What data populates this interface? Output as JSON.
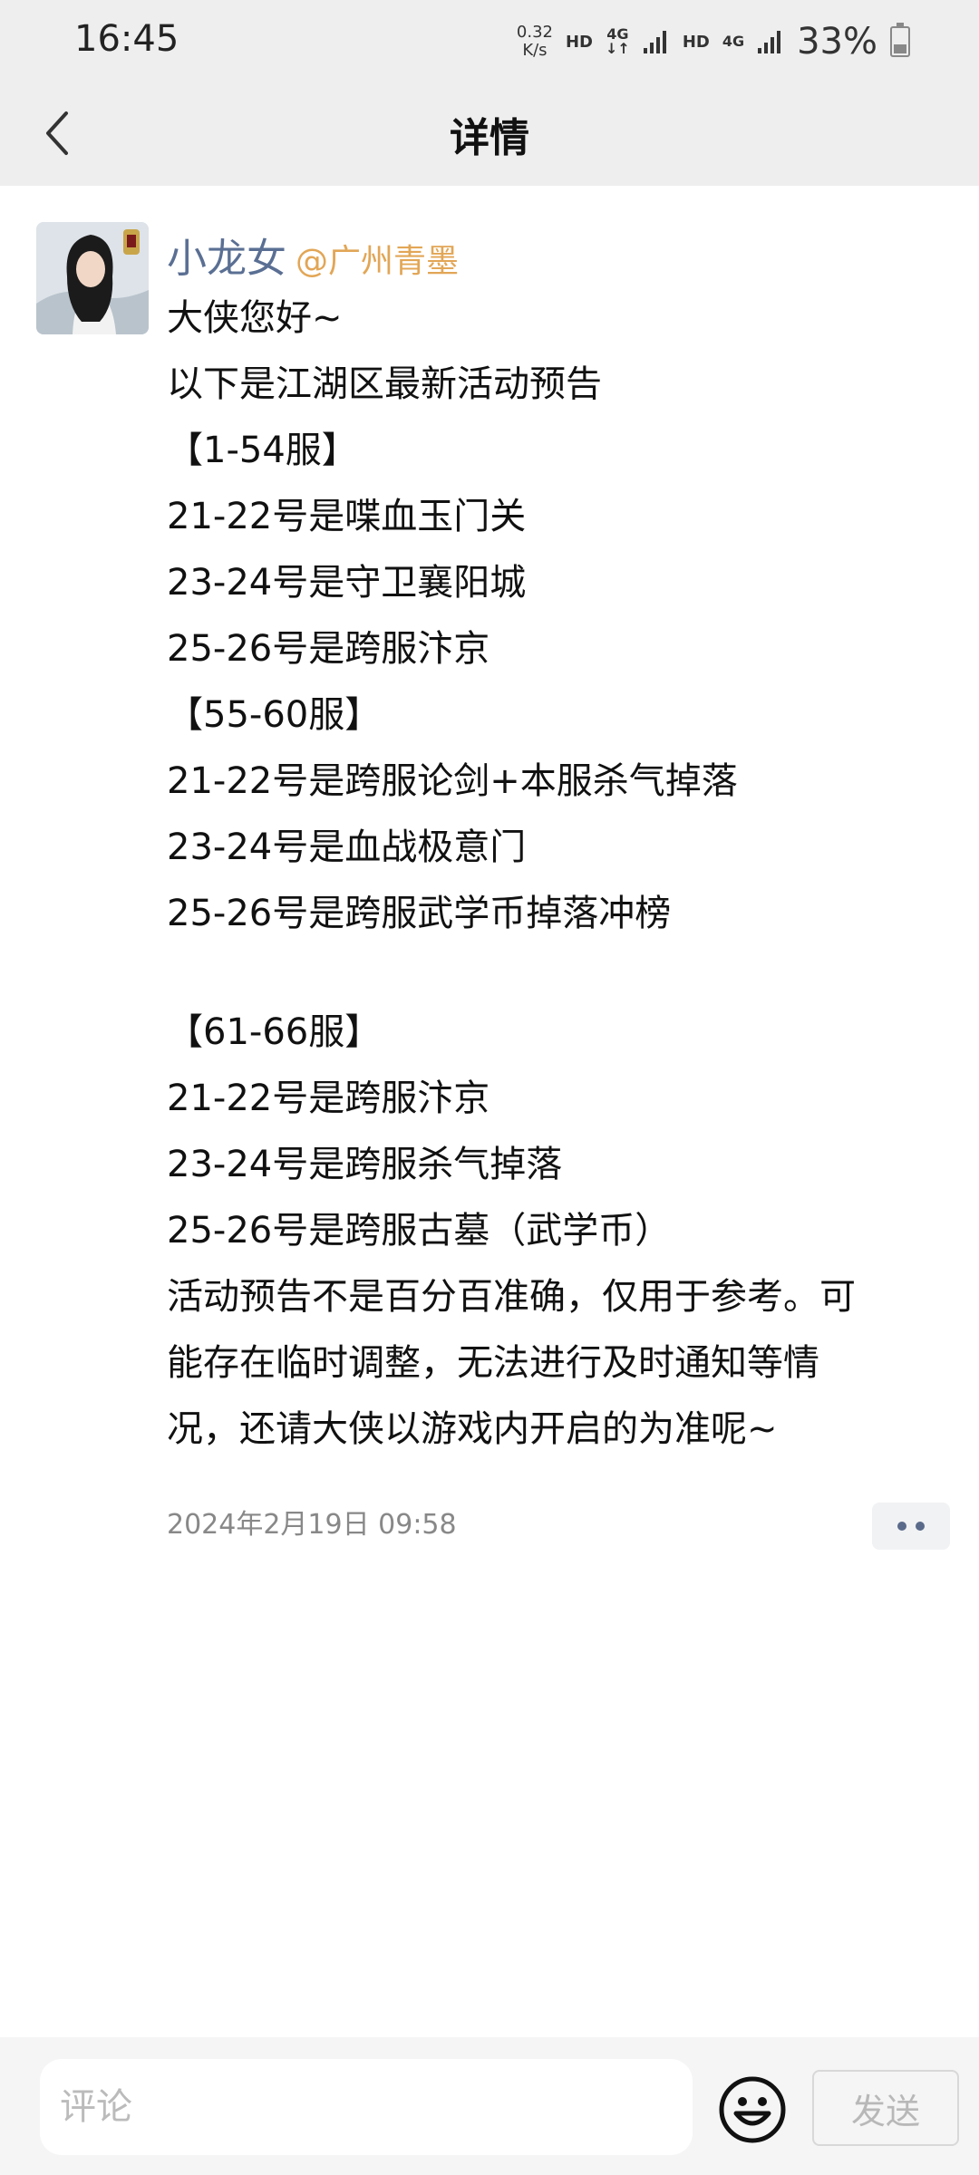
{
  "status_bar": {
    "time": "16:45",
    "net_speed_value": "0.32",
    "net_speed_unit": "K/s",
    "hd1": "HD",
    "net1": "4G",
    "hd2": "HD",
    "net2": "4G",
    "battery": "33%"
  },
  "header": {
    "title": "详情"
  },
  "post": {
    "author_name": "小龙女",
    "author_mention": "@广州青墨",
    "lines": [
      "大侠您好~",
      "以下是江湖区最新活动预告",
      "【1-54服】",
      "21-22号是喋血玉门关",
      "23-24号是守卫襄阳城",
      "25-26号是跨服汴京",
      "【55-60服】",
      "21-22号是跨服论剑+本服杀气掉落",
      "23-24号是血战极意门",
      "25-26号是跨服武学币掉落冲榜",
      "",
      "【61-66服】",
      "21-22号是跨服汴京",
      "23-24号是跨服杀气掉落",
      "25-26号是跨服古墓（武学币）",
      "活动预告不是百分百准确，仅用于参考。可",
      "能存在临时调整，无法进行及时通知等情",
      "况，还请大侠以游戏内开启的为准呢~"
    ],
    "timestamp": "2024年2月19日 09:58"
  },
  "comment_bar": {
    "placeholder": "评论",
    "send_label": "发送"
  },
  "icons": {
    "back": "chevron-left-icon",
    "more": "more-dots-icon",
    "emoji": "smiley-icon"
  },
  "colors": {
    "author_name": "#5a6f93",
    "mention": "#e2a656",
    "header_bg": "#eeeeee"
  }
}
